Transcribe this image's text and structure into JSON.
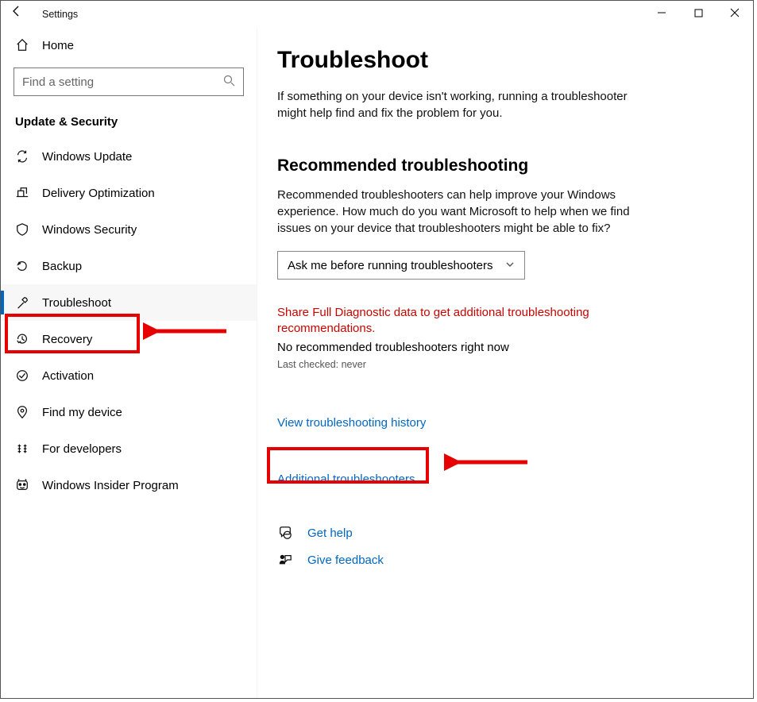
{
  "titlebar": {
    "title": "Settings"
  },
  "sidebar": {
    "home": "Home",
    "search_placeholder": "Find a setting",
    "section": "Update & Security",
    "items": [
      {
        "label": "Windows Update"
      },
      {
        "label": "Delivery Optimization"
      },
      {
        "label": "Windows Security"
      },
      {
        "label": "Backup"
      },
      {
        "label": "Troubleshoot"
      },
      {
        "label": "Recovery"
      },
      {
        "label": "Activation"
      },
      {
        "label": "Find my device"
      },
      {
        "label": "For developers"
      },
      {
        "label": "Windows Insider Program"
      }
    ]
  },
  "content": {
    "page_title": "Troubleshoot",
    "intro": "If something on your device isn't working, running a troubleshooter might help find and fix the problem for you.",
    "rec_heading": "Recommended troubleshooting",
    "rec_text": "Recommended troubleshooters can help improve your Windows experience. How much do you want Microsoft to help when we find issues on your device that troubleshooters might be able to fix?",
    "dropdown_value": "Ask me before running troubleshooters",
    "diag_warn": "Share Full Diagnostic data to get additional troubleshooting recommendations.",
    "no_rec": "No recommended troubleshooters right now",
    "last_checked": "Last checked: never",
    "history_link": "View troubleshooting history",
    "additional_link": "Additional troubleshooters",
    "get_help": "Get help",
    "give_feedback": "Give feedback"
  }
}
